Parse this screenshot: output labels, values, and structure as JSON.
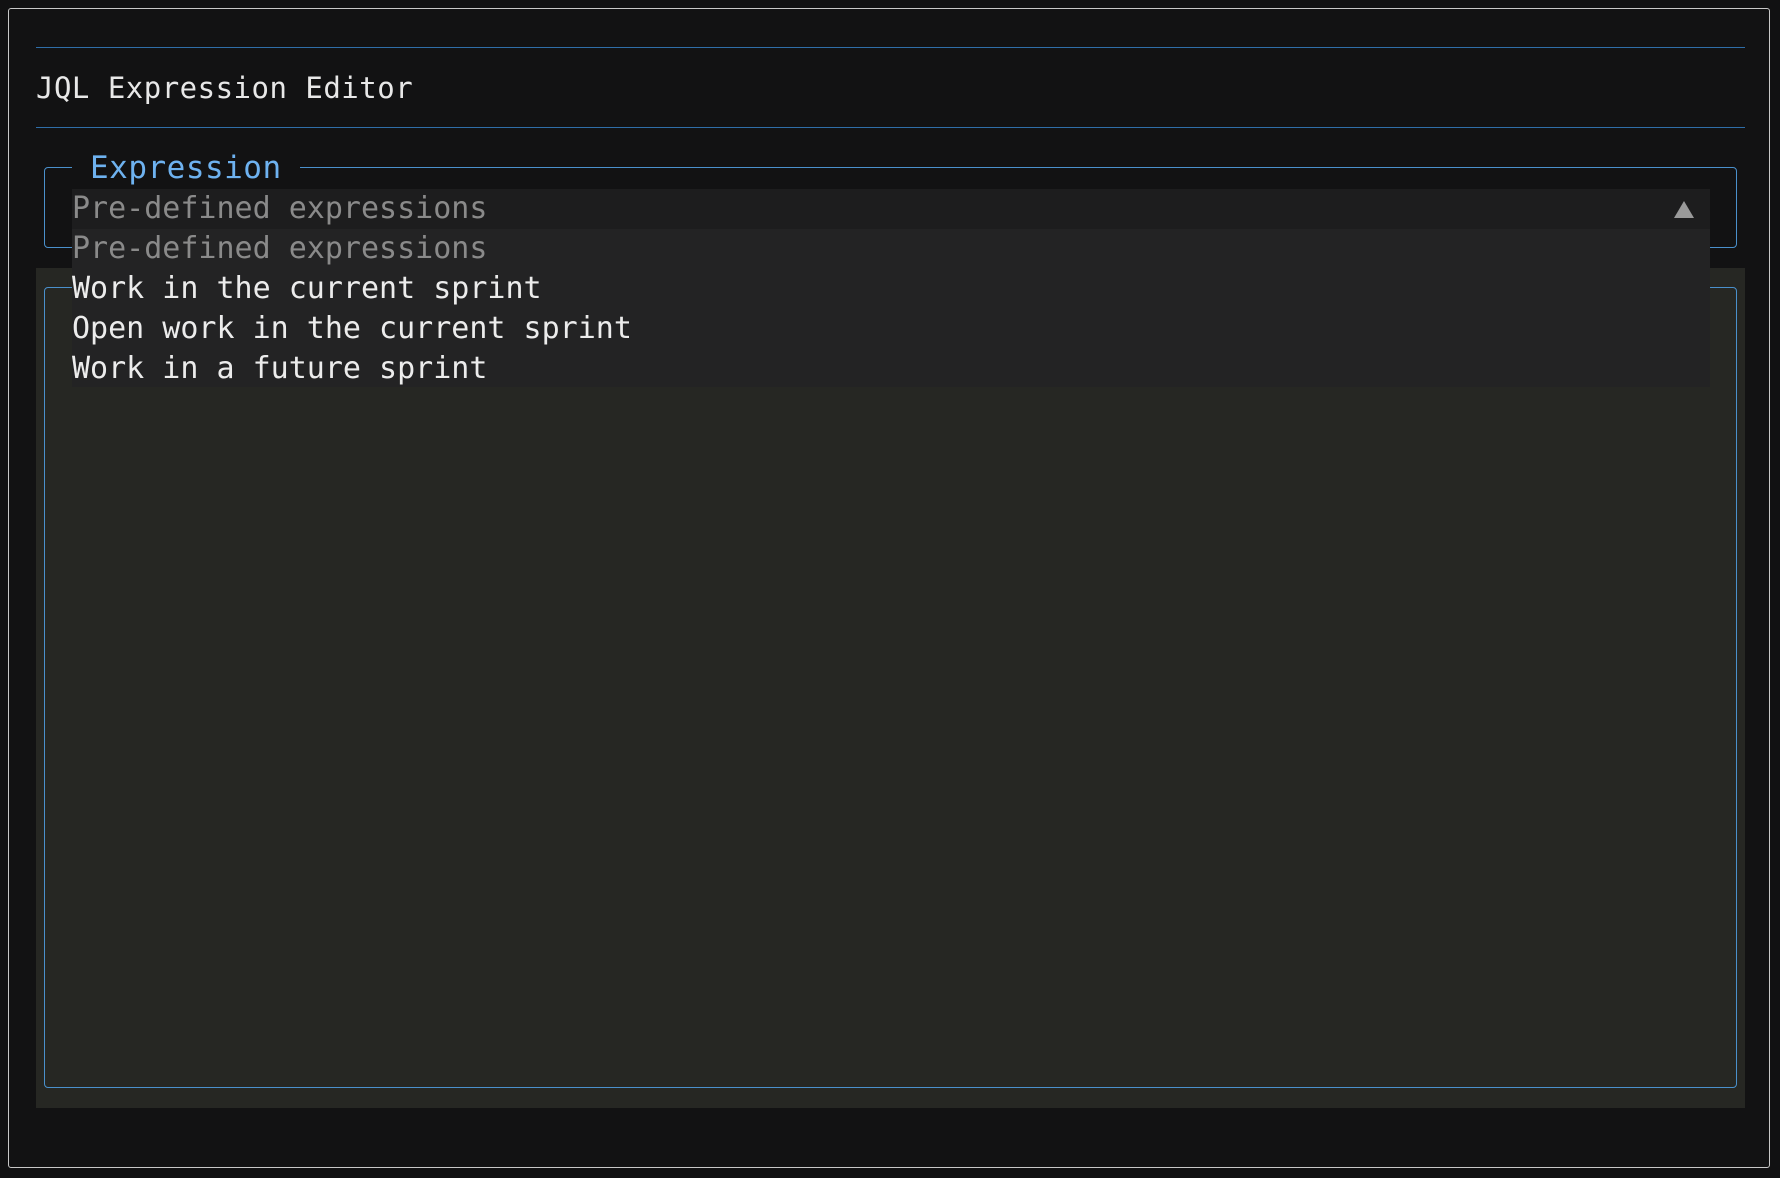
{
  "dialog": {
    "title": "JQL Expression Editor"
  },
  "expression": {
    "legend": "Expression",
    "selected_value": "Pre-defined expressions",
    "options": [
      {
        "label": "Pre-defined expressions",
        "placeholder": true
      },
      {
        "label": "Work in the current sprint",
        "placeholder": false
      },
      {
        "label": "Open work in the current sprint",
        "placeholder": false
      },
      {
        "label": "Work in a future sprint",
        "placeholder": false
      }
    ]
  },
  "editor": {
    "content": ""
  },
  "colors": {
    "accent": "#4a90cc",
    "legend_text": "#6eb2f0",
    "background": "#121213",
    "editor_background": "#262723",
    "placeholder_text": "#8a8a8a"
  }
}
